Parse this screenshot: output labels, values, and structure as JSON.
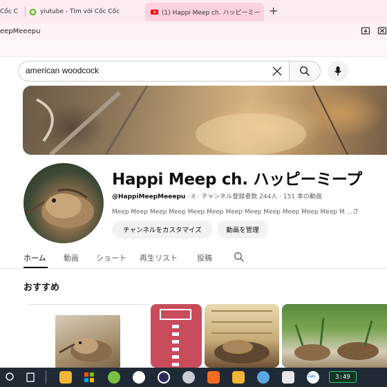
{
  "browser": {
    "tabs": [
      {
        "label": "Cốc C"
      },
      {
        "label": "yiutube - Tìm với Cốc Cốc"
      },
      {
        "label": "(1) Happi Meep ch. ハッピーミー"
      }
    ],
    "address": "eepMeeepu"
  },
  "search": {
    "value": "american woodcock"
  },
  "channel": {
    "name": "Happi Meep ch. ハッピーミープ",
    "handle": "@HappiMeepMeeepu",
    "meta_rest": " · it · チャンネル登録者数 244人 · 151 本の動画",
    "description": "Meep Meep Meep Meep Meep Meep Meep Meep Meep Meep Meep Meep M ...さ",
    "buttons": {
      "customize": "チャンネルをカスタマイズ",
      "manage": "動画を管理"
    }
  },
  "tabs": {
    "home": "ホーム",
    "videos": "動画",
    "shorts": "ショート",
    "playlists": "再生リスト",
    "posts": "投稿"
  },
  "section": {
    "title": "おすすめ"
  },
  "taskbar": {
    "clock": "3:49",
    "zalo": "Zalo"
  },
  "colors": {
    "youtube_red": "#ff0000",
    "active_tab": "#fbd1df",
    "tabstrip": "#fbeaf1"
  }
}
